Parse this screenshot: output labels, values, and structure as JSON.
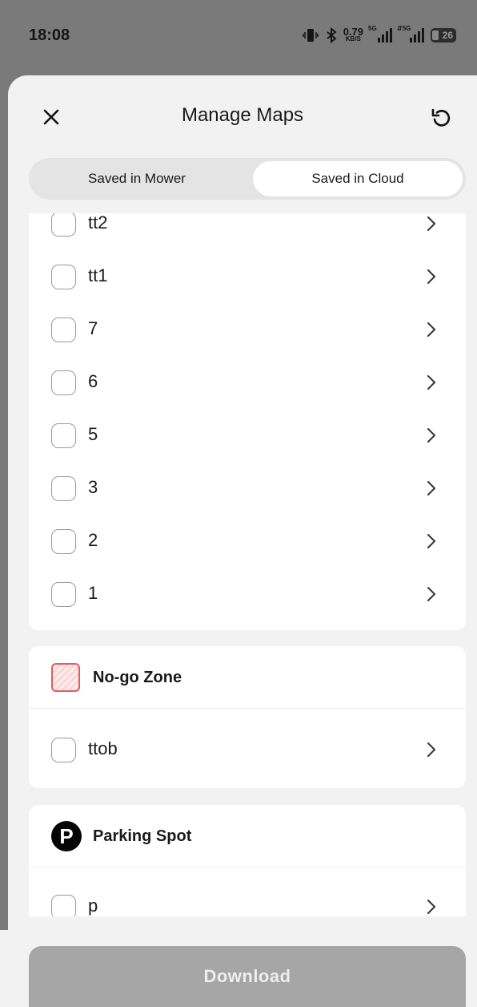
{
  "status_bar": {
    "time": "18:08",
    "net_speed_value": "0.79",
    "net_speed_unit": "KB/S",
    "signal1_label": "5G",
    "signal2_label": "⇵5G",
    "battery": "26"
  },
  "header": {
    "title": "Manage Maps",
    "close_icon": "close-icon",
    "refresh_icon": "refresh-icon"
  },
  "tabs": {
    "mower": "Saved in Mower",
    "cloud": "Saved in Cloud",
    "selected": "cloud"
  },
  "maps": {
    "items": [
      {
        "label": "tt2"
      },
      {
        "label": "tt1"
      },
      {
        "label": "7"
      },
      {
        "label": "6"
      },
      {
        "label": "5"
      },
      {
        "label": "3"
      },
      {
        "label": "2"
      },
      {
        "label": "1"
      }
    ]
  },
  "nogo": {
    "title": "No-go Zone",
    "items": [
      {
        "label": "ttob"
      }
    ]
  },
  "parking": {
    "title": "Parking Spot",
    "icon_letter": "P",
    "items": [
      {
        "label": "p"
      }
    ]
  },
  "footer": {
    "download_label": "Download"
  },
  "colors": {
    "nogo_accent": "#e65b5b",
    "download_disabled": "#a6a6a6"
  }
}
